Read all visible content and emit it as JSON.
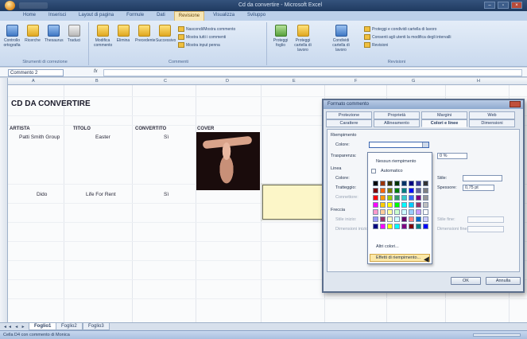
{
  "window": {
    "title": "Cd da convertire - Microsoft Excel"
  },
  "ribbon_tabs": [
    "Home",
    "Inserisci",
    "Layout di pagina",
    "Formule",
    "Dati",
    "Revisione",
    "Visualizza",
    "Sviluppo"
  ],
  "active_tab_index": 5,
  "ribbon": {
    "groups": [
      {
        "label": "Strumenti di correzione",
        "buttons": [
          "Controllo ortografia",
          "Ricerche",
          "Thesaurus",
          "Traduci"
        ]
      },
      {
        "label": "Commenti",
        "buttons": [
          "Modifica commento",
          "Elimina",
          "Precedente",
          "Successivo"
        ],
        "small": [
          "Nascondi/Mostra commento",
          "Mostra tutti i commenti",
          "Mostra input penna"
        ]
      },
      {
        "label": "Revisioni",
        "buttons": [
          "Proteggi foglio",
          "Proteggi cartella di lavoro",
          "Condividi cartella di lavoro"
        ],
        "small": [
          "Proteggi e condividi cartella di lavoro",
          "Consenti agli utenti la modifica degli intervalli",
          "Revisioni"
        ]
      }
    ]
  },
  "formula_bar": {
    "name_box": "Commento 2",
    "fx": "fx",
    "value": ""
  },
  "columns": [
    "A",
    "B",
    "C",
    "D",
    "E",
    "F",
    "G",
    "H"
  ],
  "sheet": {
    "title": "CD DA CONVERTIRE",
    "headers": {
      "artista": "ARTISTA",
      "titolo": "TITOLO",
      "convertito": "CONVERTITO",
      "cover": "COVER"
    },
    "rows": [
      {
        "artista": "Patti Smith Group",
        "titolo": "Easter",
        "convertito": "Sì"
      },
      {
        "artista": "Dido",
        "titolo": "Life For Rent",
        "convertito": "Sì"
      }
    ]
  },
  "sheet_tabs": [
    "Foglio1",
    "Foglio2",
    "Foglio3"
  ],
  "active_sheet": 0,
  "status": "Cella D4 con commento di Monica",
  "dialog": {
    "title": "Formato commento",
    "tabs_back": [
      "Protezione",
      "Proprietà",
      "Margini",
      "Web"
    ],
    "tabs_front": [
      "Carattere",
      "Allineamento",
      "Colori e linee",
      "Dimensioni"
    ],
    "active_tab": "Colori e linee",
    "section_fill": "Riempimento",
    "label_color": "Colore:",
    "label_transparency": "Trasparenza:",
    "transparency_value": "0 %",
    "section_line": "Linea",
    "label_line_color": "Colore:",
    "label_dashed": "Tratteggio:",
    "label_connector": "Connettore:",
    "label_style": "Stile:",
    "label_weight": "Spessore:",
    "weight_value": "0,75 pt",
    "section_arrows": "Freccia",
    "label_begin_style": "Stile inizio:",
    "label_begin_size": "Dimensioni inizio:",
    "label_end_style": "Stile fine:",
    "label_end_size": "Dimensioni fine:",
    "ok": "OK",
    "cancel": "Annulla"
  },
  "color_dropdown": {
    "no_fill": "Nessun riempimento",
    "automatic": "Automatico",
    "more_colors": "Altri colori...",
    "fill_effects": "Effetti di riempimento...",
    "swatches": [
      "#000000",
      "#993300",
      "#333300",
      "#003300",
      "#003366",
      "#000080",
      "#333399",
      "#333333",
      "#800000",
      "#ff6600",
      "#808000",
      "#008000",
      "#008080",
      "#0000ff",
      "#666699",
      "#808080",
      "#ff0000",
      "#ff9900",
      "#99cc00",
      "#339966",
      "#33cccc",
      "#3366ff",
      "#800080",
      "#969696",
      "#ff00ff",
      "#ffcc00",
      "#ffff00",
      "#00ff00",
      "#00ffff",
      "#00ccff",
      "#993366",
      "#c0c0c0",
      "#ff99cc",
      "#ffcc99",
      "#ffff99",
      "#ccffcc",
      "#ccffff",
      "#99ccff",
      "#cc99ff",
      "#ffffff",
      "#9999ff",
      "#993366",
      "#ffffcc",
      "#ccffff",
      "#660066",
      "#ff8080",
      "#0066cc",
      "#ccccff",
      "#000080",
      "#ff00ff",
      "#ffff00",
      "#00ffff",
      "#800080",
      "#800000",
      "#008080",
      "#0000ff"
    ]
  },
  "colors": {
    "comment_fill": "#fcf6c8",
    "ribbon_active_tab": "#f6e6b6"
  }
}
